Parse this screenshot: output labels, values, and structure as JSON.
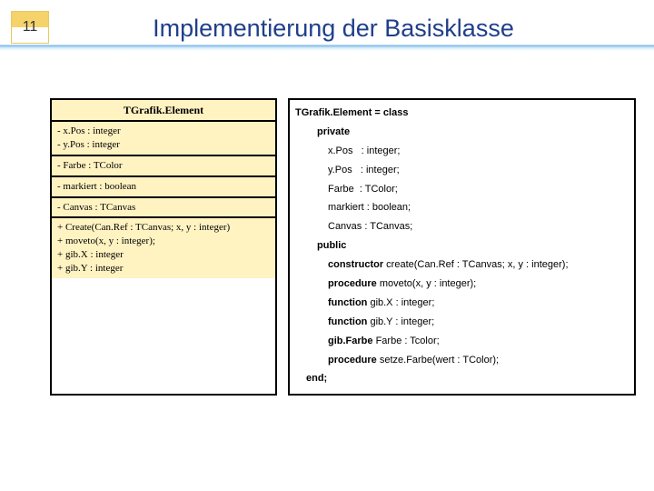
{
  "header": {
    "page_number": "11",
    "title": "Implementierung der Basisklasse"
  },
  "uml": {
    "class_name": "TGrafik.Element",
    "section1": [
      "- x.Pos : integer",
      "- y.Pos : integer"
    ],
    "section2": [
      "- Farbe : TColor"
    ],
    "section3": [
      "- markiert : boolean"
    ],
    "section4": [
      "- Canvas : TCanvas"
    ],
    "section5": [
      "+ Create(Can.Ref : TCanvas; x, y : integer)",
      "+ moveto(x, y : integer);",
      "+ gib.X : integer",
      "+ gib.Y : integer"
    ]
  },
  "code": {
    "l1a": "TGrafik.Element = ",
    "l1b": "class",
    "l2": "private",
    "l3": "x.Pos   : integer;",
    "l4": "y.Pos   : integer;",
    "l5": "Farbe  : TColor;",
    "l6": "markiert : boolean;",
    "l7": "Canvas : TCanvas;",
    "l8": "public",
    "l9a": "constructor",
    "l9b": " create(Can.Ref : TCanvas; x, y : integer);",
    "l10a": "procedure",
    "l10b": " moveto(x, y : integer);",
    "l11a": "function",
    "l11b": " gib.X : integer;",
    "l12a": "function",
    "l12b": " gib.Y : integer;",
    "l13a": "gib.Farbe",
    "l13b": " Farbe : Tcolor;",
    "l14a": "procedure",
    "l14b": " setze.Farbe(wert : TColor);",
    "l15": "end;"
  }
}
